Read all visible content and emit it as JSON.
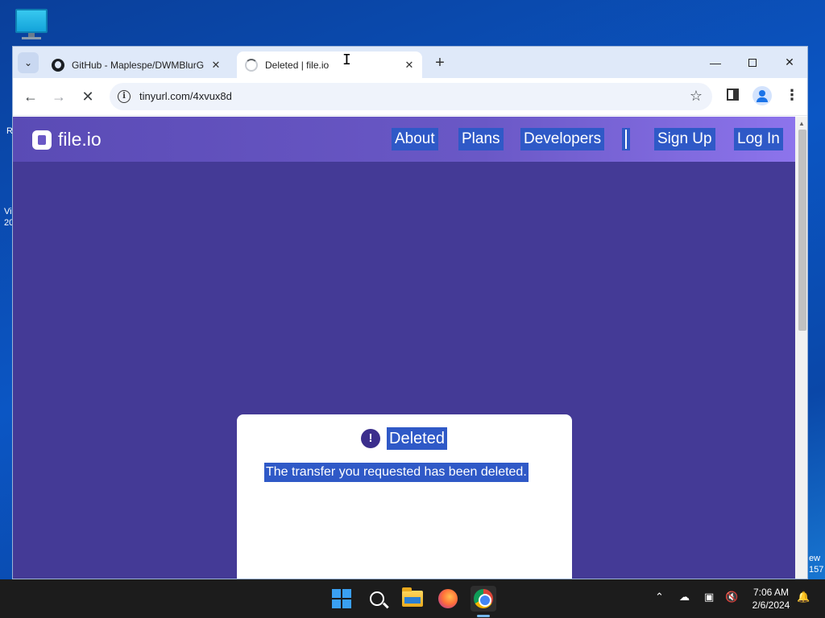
{
  "desktop": {
    "fragments": [
      "R",
      "Vi",
      "20",
      "ew",
      "157"
    ]
  },
  "browser": {
    "tabs": [
      {
        "title": "GitHub - Maplespe/DWMBlurG",
        "state": "inactive"
      },
      {
        "title": "Deleted | file.io",
        "state": "active"
      }
    ],
    "address_bar": {
      "url": "tinyurl.com/4xvux8d"
    }
  },
  "page": {
    "logo_text": "file.io",
    "nav": [
      "About",
      "Plans",
      "Developers",
      "Sign Up",
      "Log In"
    ],
    "card": {
      "heading": "Deleted",
      "message": "The transfer you requested has been deleted."
    },
    "colors": {
      "page_bg": "#443a96",
      "header_bg": "#6a58c6",
      "selection": "#2f59c7"
    }
  },
  "taskbar": {
    "icons": [
      "windows-start-icon",
      "search-icon",
      "file-explorer-icon",
      "firefox-icon",
      "chrome-icon"
    ],
    "clock": {
      "time": "7:06 AM",
      "date": "2/6/2024"
    }
  }
}
